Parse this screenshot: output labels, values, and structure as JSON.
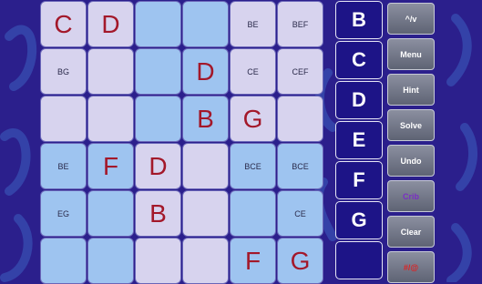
{
  "grid": {
    "rows": [
      [
        {
          "text": "C",
          "size": "big",
          "shade": "light"
        },
        {
          "text": "D",
          "size": "big",
          "shade": "light"
        },
        {
          "text": "",
          "size": "big",
          "shade": "blue"
        },
        {
          "text": "",
          "size": "big",
          "shade": "blue"
        },
        {
          "text": "BE",
          "size": "small",
          "shade": "light"
        },
        {
          "text": "BEF",
          "size": "small",
          "shade": "light"
        }
      ],
      [
        {
          "text": "BG",
          "size": "small",
          "shade": "light"
        },
        {
          "text": "",
          "size": "big",
          "shade": "light"
        },
        {
          "text": "",
          "size": "big",
          "shade": "blue"
        },
        {
          "text": "D",
          "size": "big",
          "shade": "blue"
        },
        {
          "text": "CE",
          "size": "small",
          "shade": "light"
        },
        {
          "text": "CEF",
          "size": "small",
          "shade": "light"
        }
      ],
      [
        {
          "text": "",
          "size": "big",
          "shade": "light"
        },
        {
          "text": "",
          "size": "big",
          "shade": "light"
        },
        {
          "text": "",
          "size": "big",
          "shade": "blue"
        },
        {
          "text": "B",
          "size": "big",
          "shade": "blue"
        },
        {
          "text": "G",
          "size": "big",
          "shade": "light"
        },
        {
          "text": "",
          "size": "big",
          "shade": "light"
        }
      ],
      [
        {
          "text": "BE",
          "size": "small",
          "shade": "blue"
        },
        {
          "text": "F",
          "size": "big",
          "shade": "blue"
        },
        {
          "text": "D",
          "size": "big",
          "shade": "light"
        },
        {
          "text": "",
          "size": "big",
          "shade": "light"
        },
        {
          "text": "BCE",
          "size": "small",
          "shade": "blue"
        },
        {
          "text": "BCE",
          "size": "small",
          "shade": "blue"
        }
      ],
      [
        {
          "text": "EG",
          "size": "small",
          "shade": "blue"
        },
        {
          "text": "",
          "size": "big",
          "shade": "blue"
        },
        {
          "text": "B",
          "size": "big",
          "shade": "light"
        },
        {
          "text": "",
          "size": "big",
          "shade": "light"
        },
        {
          "text": "",
          "size": "big",
          "shade": "blue"
        },
        {
          "text": "CE",
          "size": "small",
          "shade": "blue"
        }
      ],
      [
        {
          "text": "",
          "size": "big",
          "shade": "blue"
        },
        {
          "text": "",
          "size": "big",
          "shade": "blue"
        },
        {
          "text": "",
          "size": "big",
          "shade": "light"
        },
        {
          "text": "",
          "size": "big",
          "shade": "light"
        },
        {
          "text": "F",
          "size": "big",
          "shade": "blue"
        },
        {
          "text": "G",
          "size": "big",
          "shade": "blue"
        }
      ]
    ]
  },
  "picker": {
    "letters": [
      "B",
      "C",
      "D",
      "E",
      "F",
      "G",
      ""
    ]
  },
  "controls": {
    "toggle_label": "^/v",
    "menu_label": "Menu",
    "hint_label": "Hint",
    "solve_label": "Solve",
    "undo_label": "Undo",
    "crib_label": "Crib",
    "clear_label": "Clear",
    "mark_label": "#/@"
  },
  "colors": {
    "background": "#2b1f8c",
    "cell_light": "#d7d3ee",
    "cell_blue": "#9ec4f0",
    "letter": "#a3182a",
    "picker_bg": "#1d1487",
    "crib_text": "#7a2fc4",
    "mark_text": "#e02121"
  }
}
